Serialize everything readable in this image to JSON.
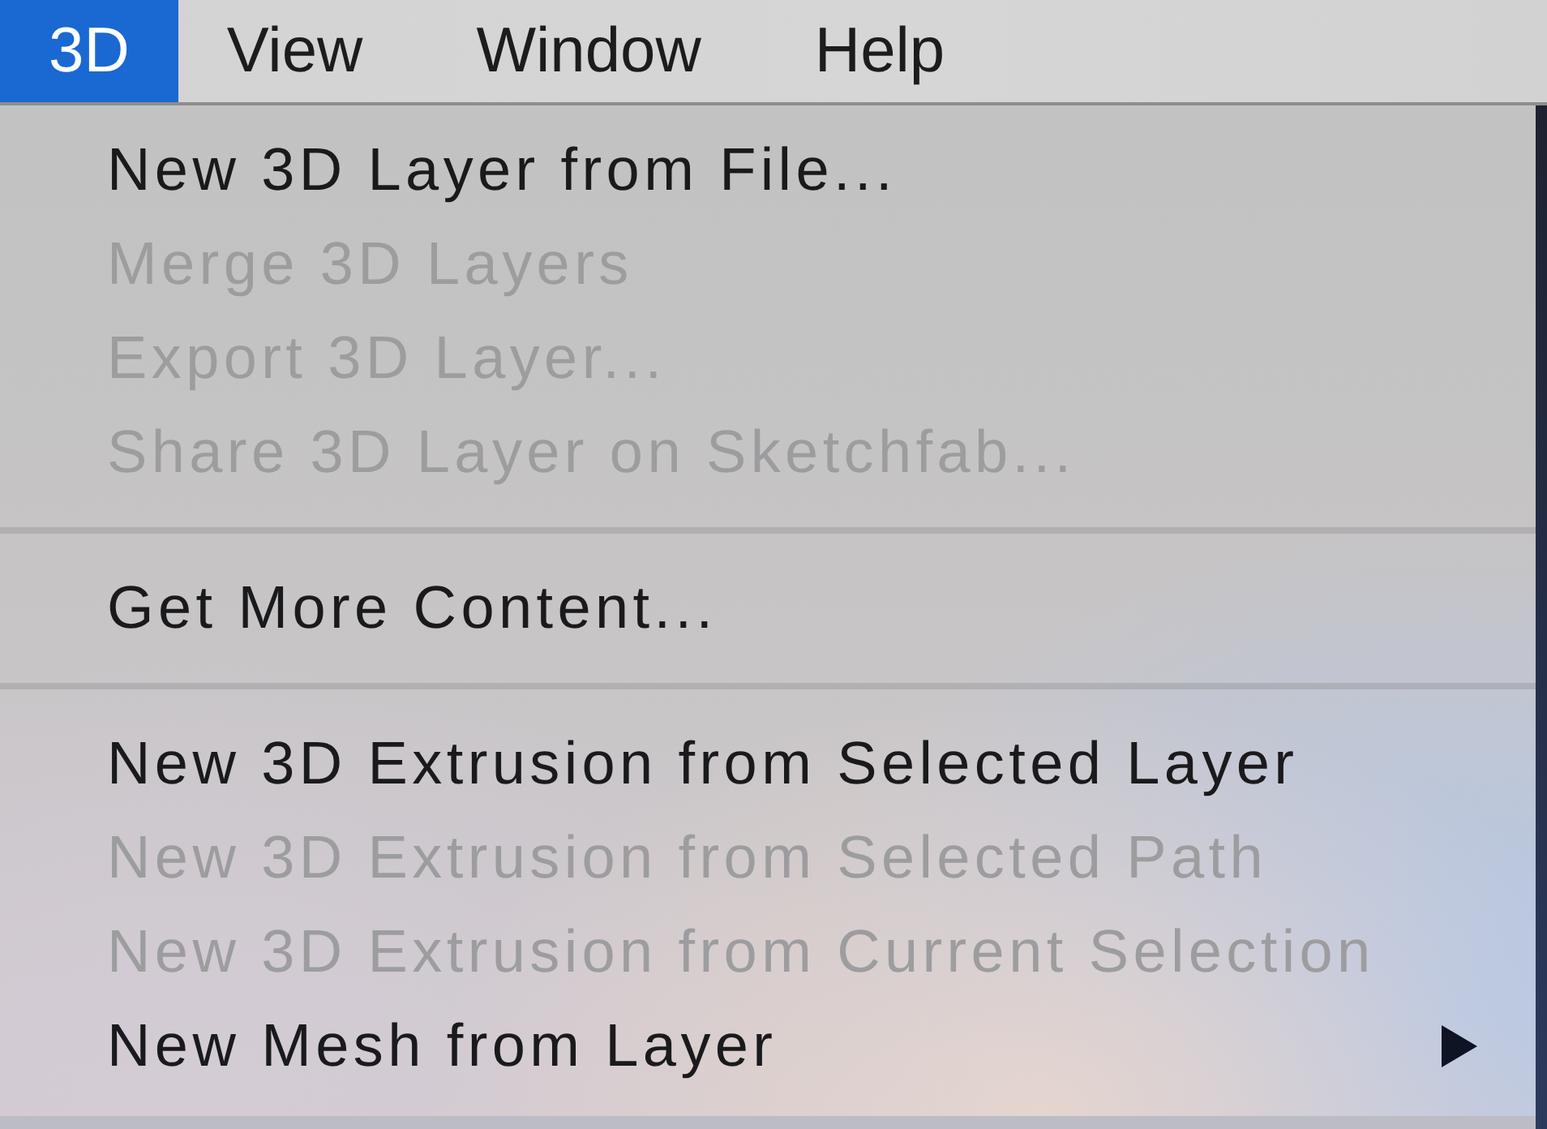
{
  "menu_bar": {
    "items": [
      {
        "label": "3D",
        "selected": true
      },
      {
        "label": "View",
        "selected": false
      },
      {
        "label": "Window",
        "selected": false
      },
      {
        "label": "Help",
        "selected": false
      }
    ]
  },
  "menu": {
    "items": [
      {
        "kind": "item",
        "label": "New 3D Layer from File...",
        "disabled": false,
        "submenu": false
      },
      {
        "kind": "item",
        "label": "Merge 3D Layers",
        "disabled": true,
        "submenu": false
      },
      {
        "kind": "item",
        "label": "Export 3D Layer...",
        "disabled": true,
        "submenu": false
      },
      {
        "kind": "item",
        "label": "Share 3D Layer on Sketchfab...",
        "disabled": true,
        "submenu": false
      },
      {
        "kind": "separator"
      },
      {
        "kind": "item",
        "label": "Get More Content...",
        "disabled": false,
        "submenu": false
      },
      {
        "kind": "separator"
      },
      {
        "kind": "item",
        "label": "New 3D Extrusion from Selected Layer",
        "disabled": false,
        "submenu": false
      },
      {
        "kind": "item",
        "label": "New 3D Extrusion from Selected Path",
        "disabled": true,
        "submenu": false
      },
      {
        "kind": "item",
        "label": "New 3D Extrusion from Current Selection",
        "disabled": true,
        "submenu": false
      },
      {
        "kind": "item",
        "label": "New Mesh from Layer",
        "disabled": false,
        "submenu": true
      }
    ]
  }
}
